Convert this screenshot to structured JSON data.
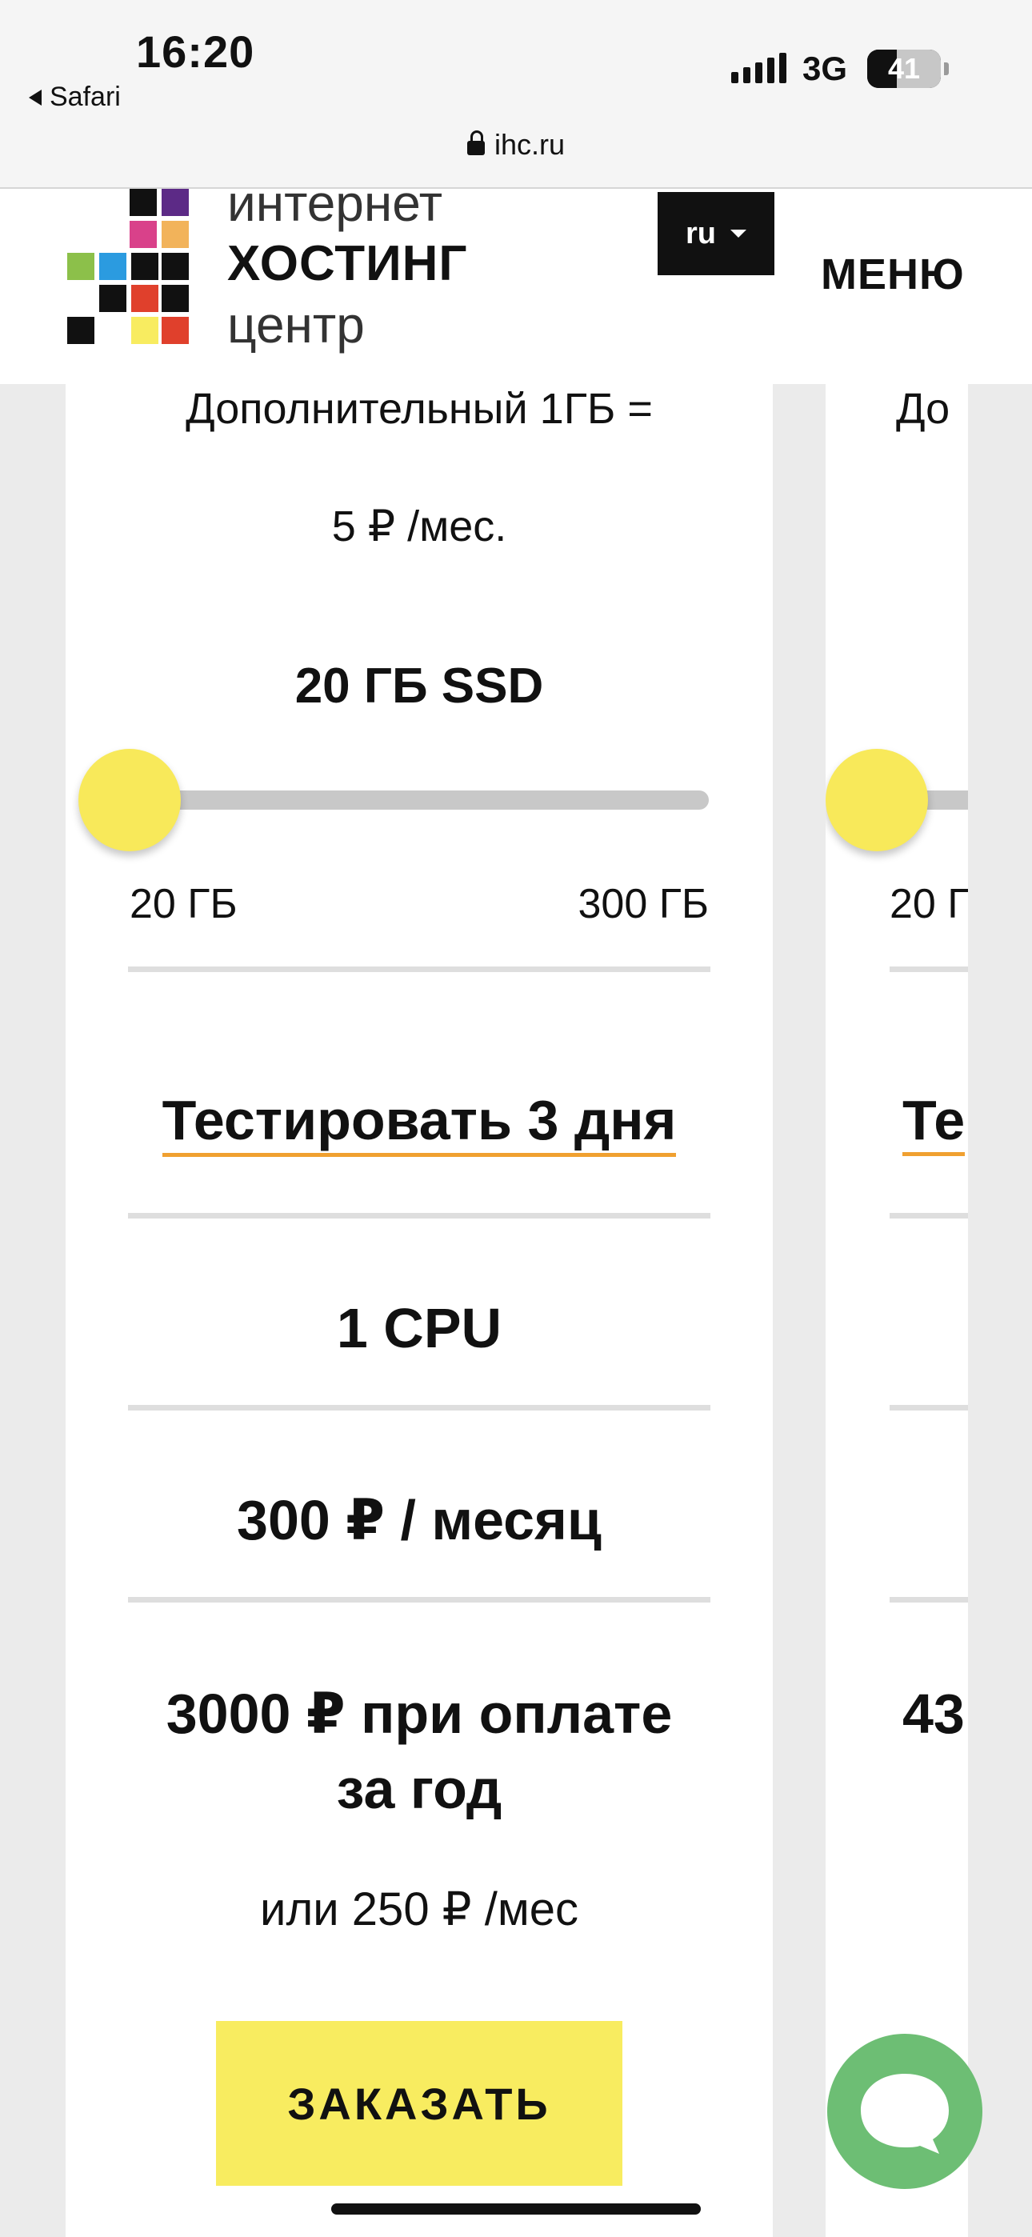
{
  "status_bar": {
    "time": "16:20",
    "back_app": "Safari",
    "network": "3G",
    "battery": "41"
  },
  "browser": {
    "url": "ihc.ru"
  },
  "header": {
    "logo_line1": "интернет",
    "logo_line2": "ХОСТИНГ",
    "logo_line3": "центр",
    "lang_label": "ru",
    "menu_label": "МЕНЮ"
  },
  "plan": {
    "extra_gb_line1": "Дополнительный 1ГБ =",
    "extra_gb_line2": "5 ₽ /мес.",
    "storage_value": "20 ГБ SSD",
    "slider_min": "20 ГБ",
    "slider_max": "300 ГБ",
    "slider_level": 0,
    "test_link": "Тестировать 3 дня",
    "cpu": "1 CPU",
    "price_month": "300 ₽ / месяц",
    "price_year_line1": "3000 ₽ при оплате",
    "price_year_line2": "за год",
    "price_alt": "или 250 ₽ /мес",
    "order_button": "ЗАКАЗАТЬ"
  },
  "next_plan_partial": {
    "extra_gb_fragment": "До",
    "slider_min_fragment": "20 Г",
    "test_fragment": "Те",
    "price_year_fragment": "43"
  },
  "colors": {
    "accent_yellow": "#f8ec60",
    "underline_orange": "#f0a030",
    "chat_green": "#6dbe74"
  },
  "icons": [
    "lock-icon",
    "caret-down-icon",
    "chat-bubble-icon",
    "signal-icon",
    "battery-icon"
  ]
}
